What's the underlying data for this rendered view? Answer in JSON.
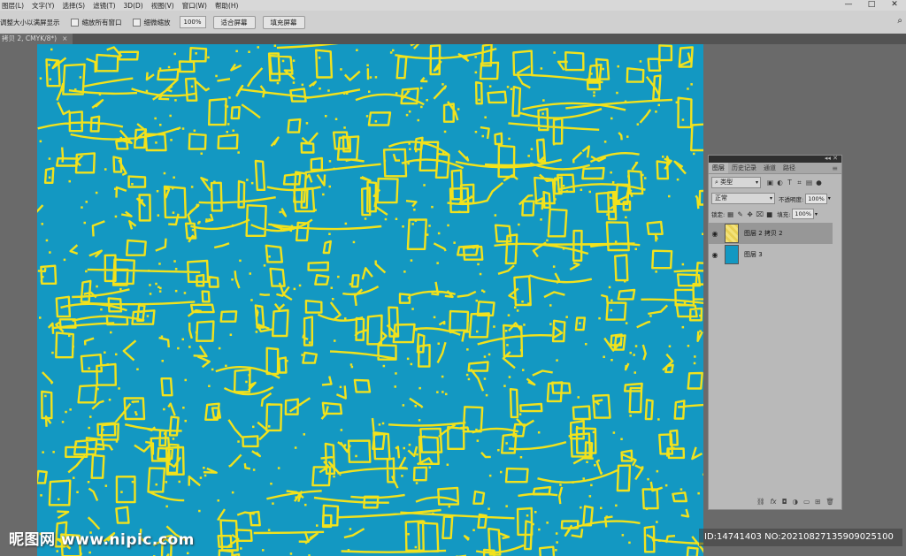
{
  "menubar": {
    "items": [
      "图层(L)",
      "文字(Y)",
      "选择(S)",
      "滤镜(T)",
      "3D(D)",
      "视图(V)",
      "窗口(W)",
      "帮助(H)"
    ],
    "window_controls": [
      "—",
      "□",
      "✕"
    ]
  },
  "options": {
    "fit_label": "调整大小以满屏显示",
    "zoom_all_label": "缩放所有窗口",
    "scrubby_label": "细微缩放",
    "zoom_value": "100%",
    "fit_screen_button": "适合屏幕",
    "fill_screen_button": "填充屏幕"
  },
  "document_tab": {
    "title": "拷贝 2, CMYK/8*)",
    "close": "×"
  },
  "canvas": {
    "pattern_colors": {
      "background": "#1398c2",
      "lines": "#f2e21c"
    }
  },
  "layers_panel": {
    "tabs": [
      "图层",
      "历史记录",
      "通道",
      "路径"
    ],
    "filter_label": "类型",
    "blend_mode": "正常",
    "opacity_label": "不透明度:",
    "opacity_value": "100%",
    "lock_label": "锁定:",
    "fill_label": "填充:",
    "fill_value": "100%",
    "layers": [
      {
        "name": "图层 2 拷贝 2",
        "selected": true,
        "thumb": "yellow-pattern"
      },
      {
        "name": "图层 3",
        "selected": false,
        "thumb": "blue-fill"
      }
    ],
    "footer_icons": [
      "link-icon",
      "fx-icon",
      "mask-icon",
      "adjustment-icon",
      "group-icon",
      "new-layer-icon",
      "trash-icon"
    ]
  },
  "watermark": {
    "left": "昵图网 www.nipic.com",
    "right": "ID:14741403 NO:20210827135909025100"
  }
}
